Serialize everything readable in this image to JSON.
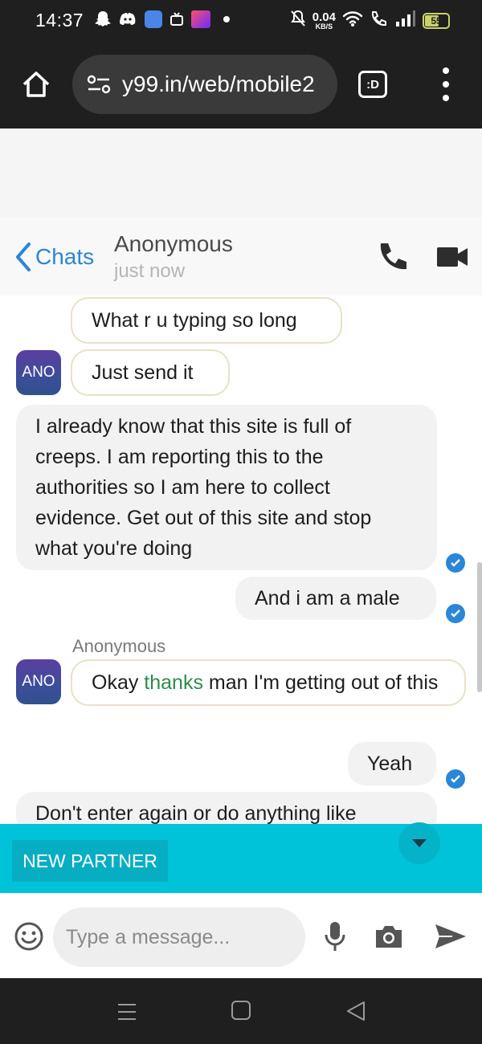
{
  "status_bar": {
    "time": "14:37",
    "net_speed": "0.04",
    "net_unit": "KB/S",
    "battery": "55",
    "notification_icons": [
      "snapchat-icon",
      "discord-icon",
      "app-icon",
      "tv-icon",
      "sonyliv-icon",
      "dot-icon"
    ],
    "system_icons": [
      "mute-icon",
      "wifi-icon",
      "wifi-call-icon",
      "signal-icon",
      "battery-icon"
    ]
  },
  "browser": {
    "url": "y99.in/web/mobile2",
    "tab_label": ":D"
  },
  "chat_header": {
    "back_label": "Chats",
    "contact_name": "Anonymous",
    "contact_status": "just now"
  },
  "messages": {
    "m1": "What r u typing so long",
    "m2": "Just send it",
    "m3": "I already know that this site is full of creeps. I am reporting this to the authorities so I am here to collect evidence. Get out of this site and stop what you're doing",
    "m4": "And i am a male",
    "m5_before": "Okay ",
    "m5_highlight": "thanks",
    "m5_after": " man I'm getting out of this",
    "m6": "Yeah",
    "m7": "Don't enter again or do anything like",
    "avatar_label": "ANO",
    "sender_label": "Anonymous"
  },
  "actions": {
    "new_partner": "NEW PARTNER"
  },
  "composer": {
    "placeholder": "Type a message..."
  },
  "colors": {
    "accent_blue": "#2a86d8",
    "action_bar": "#00c3d9",
    "highlight_green": "#2f8a4e"
  }
}
